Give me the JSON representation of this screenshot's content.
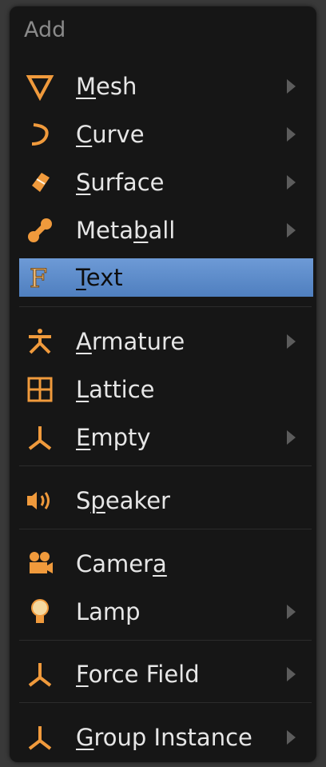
{
  "menu": {
    "title": "Add",
    "items": [
      {
        "key": "mesh",
        "pre": "",
        "ul": "M",
        "post": "esh",
        "icon": "mesh-icon",
        "submenu": true
      },
      {
        "key": "curve",
        "pre": "",
        "ul": "C",
        "post": "urve",
        "icon": "curve-icon",
        "submenu": true
      },
      {
        "key": "surface",
        "pre": "",
        "ul": "S",
        "post": "urface",
        "icon": "surface-icon",
        "submenu": true
      },
      {
        "key": "metaball",
        "pre": "Meta",
        "ul": "b",
        "post": "all",
        "icon": "metaball-icon",
        "submenu": true
      },
      {
        "key": "text",
        "pre": "",
        "ul": "T",
        "post": "ext",
        "icon": "text-icon",
        "submenu": false,
        "active": true
      },
      {
        "key": "armature",
        "pre": "",
        "ul": "A",
        "post": "rmature",
        "icon": "armature-icon",
        "submenu": true
      },
      {
        "key": "lattice",
        "pre": "",
        "ul": "L",
        "post": "attice",
        "icon": "lattice-icon",
        "submenu": false
      },
      {
        "key": "empty",
        "pre": "",
        "ul": "E",
        "post": "mpty",
        "icon": "empty-icon",
        "submenu": true
      },
      {
        "key": "speaker",
        "pre": "S",
        "ul": "p",
        "post": "eaker",
        "icon": "speaker-icon",
        "submenu": false
      },
      {
        "key": "camera",
        "pre": "Camer",
        "ul": "a",
        "post": "",
        "icon": "camera-icon",
        "submenu": false
      },
      {
        "key": "lamp",
        "pre": "",
        "ul": "",
        "post": "Lamp",
        "icon": "lamp-icon",
        "submenu": true
      },
      {
        "key": "force-field",
        "pre": "",
        "ul": "F",
        "post": "orce Field",
        "icon": "force-field-icon",
        "submenu": true
      },
      {
        "key": "group-instance",
        "pre": "",
        "ul": "G",
        "post": "roup Instance",
        "icon": "group-instance-icon",
        "submenu": true
      }
    ]
  },
  "colors": {
    "accent_icon": "#f09a3c",
    "highlight": "#5a88c8",
    "menu_bg": "#161616"
  }
}
